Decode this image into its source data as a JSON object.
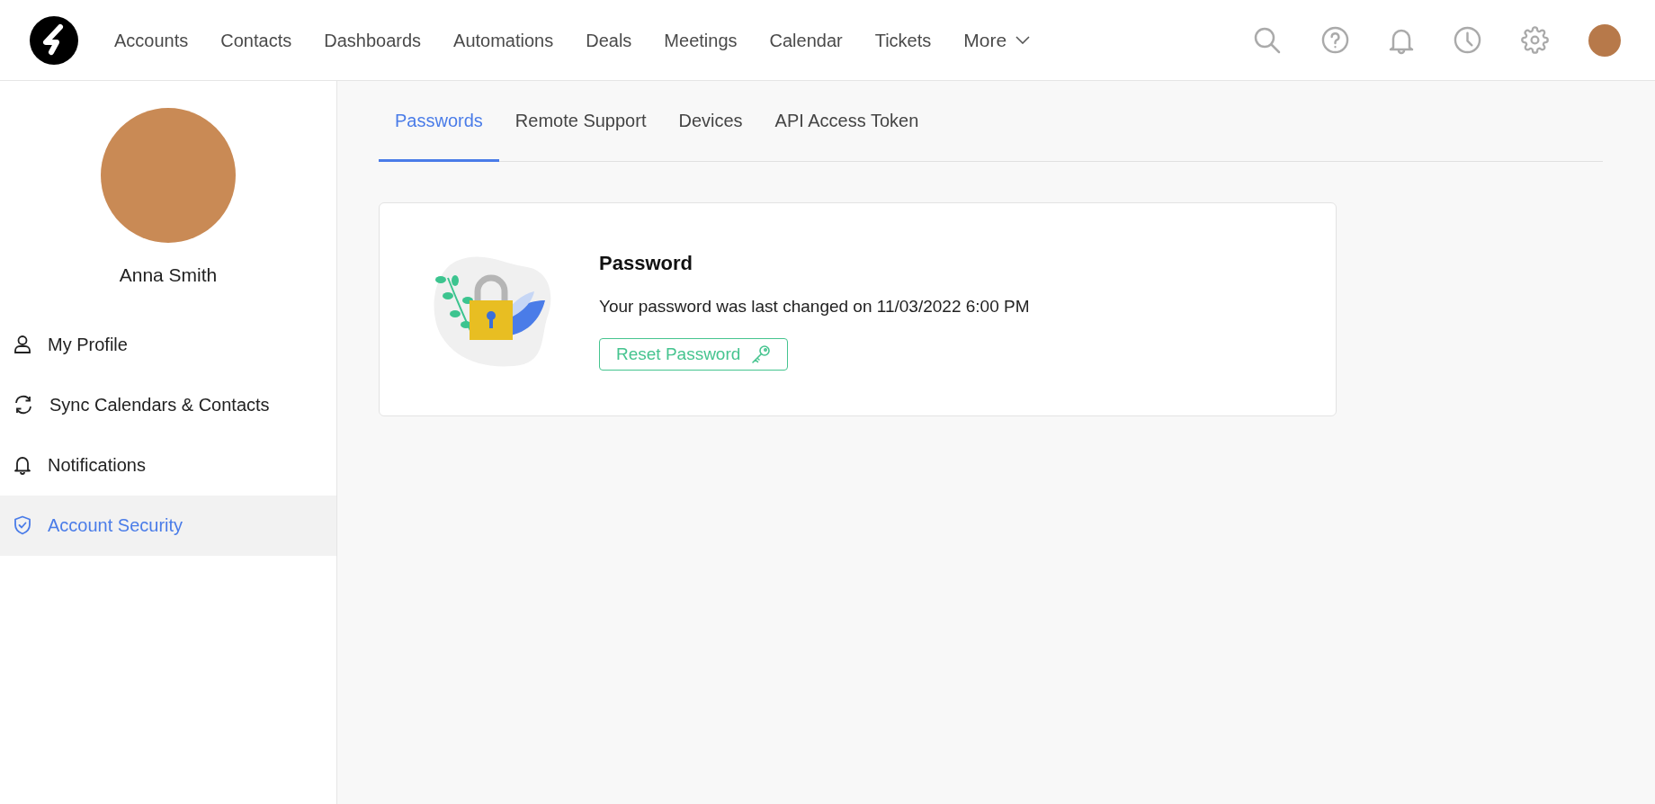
{
  "top_nav": {
    "items": [
      {
        "label": "Accounts"
      },
      {
        "label": "Contacts"
      },
      {
        "label": "Dashboards"
      },
      {
        "label": "Automations"
      },
      {
        "label": "Deals"
      },
      {
        "label": "Meetings"
      },
      {
        "label": "Calendar"
      },
      {
        "label": "Tickets"
      }
    ],
    "more_label": "More"
  },
  "sidebar": {
    "user_name": "Anna Smith",
    "items": [
      {
        "label": "My Profile",
        "selected": false
      },
      {
        "label": "Sync Calendars & Contacts",
        "selected": false
      },
      {
        "label": "Notifications",
        "selected": false
      },
      {
        "label": "Account Security",
        "selected": true
      }
    ]
  },
  "tabs": [
    {
      "label": "Passwords",
      "selected": true
    },
    {
      "label": "Remote Support",
      "selected": false
    },
    {
      "label": "Devices",
      "selected": false
    },
    {
      "label": "API Access Token",
      "selected": false
    }
  ],
  "password_card": {
    "title": "Password",
    "message": "Your password was last changed on 11/03/2022 6:00 PM",
    "button": "Reset Password"
  }
}
